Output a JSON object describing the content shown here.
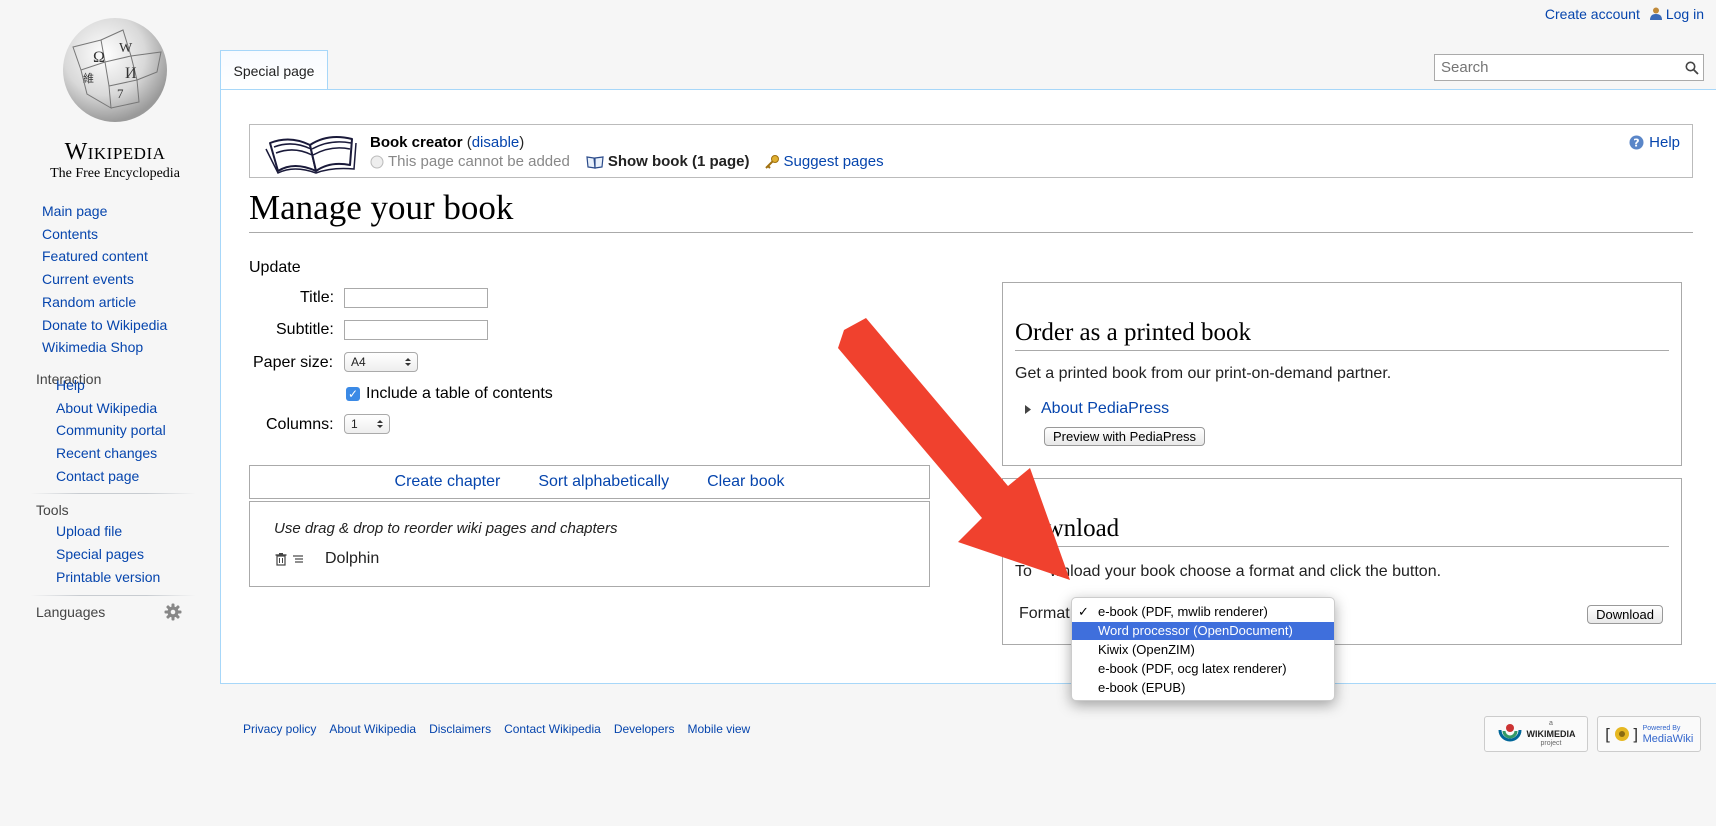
{
  "personal": {
    "create_account": "Create account",
    "login": "Log in"
  },
  "logo": {
    "wordmark": "Wikipedia",
    "tagline": "The Free Encyclopedia"
  },
  "sidebar": {
    "nav": [
      "Main page",
      "Contents",
      "Featured content",
      "Current events",
      "Random article",
      "Donate to Wikipedia",
      "Wikimedia Shop"
    ],
    "interaction": {
      "heading": "Interaction",
      "items": [
        "Help",
        "About Wikipedia",
        "Community portal",
        "Recent changes",
        "Contact page"
      ]
    },
    "tools": {
      "heading": "Tools",
      "items": [
        "Upload file",
        "Special pages",
        "Printable version"
      ]
    },
    "languages": {
      "heading": "Languages",
      "icon": "gear-icon"
    }
  },
  "tabs": {
    "special": "Special page"
  },
  "search": {
    "placeholder": "Search",
    "icon": "search-icon"
  },
  "book_creator": {
    "title": "Book creator",
    "disable_open": "(",
    "disable": "disable",
    "disable_close": ")",
    "cannot_add": "This page cannot be added",
    "show_book": "Show book (1 page)",
    "suggest": "Suggest pages",
    "help": "Help"
  },
  "page_title": "Manage your book",
  "update": {
    "heading": "Update",
    "title_label": "Title:",
    "subtitle_label": "Subtitle:",
    "paper_label": "Paper size:",
    "paper_value": "A4",
    "toc_label": "Include a table of contents",
    "columns_label": "Columns:",
    "columns_value": "1"
  },
  "chapters": {
    "create": "Create chapter",
    "sort": "Sort alphabetically",
    "clear": "Clear book"
  },
  "list": {
    "hint": "Use drag & drop to reorder wiki pages and chapters",
    "items": [
      "Dolphin"
    ]
  },
  "order": {
    "heading": "Order as a printed book",
    "description": "Get a printed book from our print-on-demand partner.",
    "about": "About PediaPress",
    "preview_button": "Preview with PediaPress"
  },
  "download": {
    "heading": "Download",
    "heading_visible": "wnload",
    "description": "To download your book choose a format and click the button.",
    "description_visible_left": "To",
    "description_visible_right": "wnload your book choose a format and click the button.",
    "format_label": "Format",
    "button": "Download",
    "options": [
      "e-book (PDF, mwlib renderer)",
      "Word processor (OpenDocument)",
      "Kiwix (OpenZIM)",
      "e-book (PDF, ocg latex renderer)",
      "e-book (EPUB)"
    ],
    "checked_option": "e-book (PDF, mwlib renderer)",
    "highlighted_option": "Word processor (OpenDocument)"
  },
  "footer": {
    "links": [
      "Privacy policy",
      "About Wikipedia",
      "Disclaimers",
      "Contact Wikipedia",
      "Developers",
      "Mobile view"
    ],
    "wikimedia_badge": "WIKIMEDIA",
    "wikimedia_a": "a",
    "wikimedia_project": "project",
    "mediawiki_powered": "Powered By",
    "mediawiki_badge": "MediaWiki"
  },
  "colors": {
    "link": "#0645ad",
    "arrow": "#f0412e",
    "highlight": "#3f6fdc",
    "tab_border": "#a7d7f9"
  }
}
